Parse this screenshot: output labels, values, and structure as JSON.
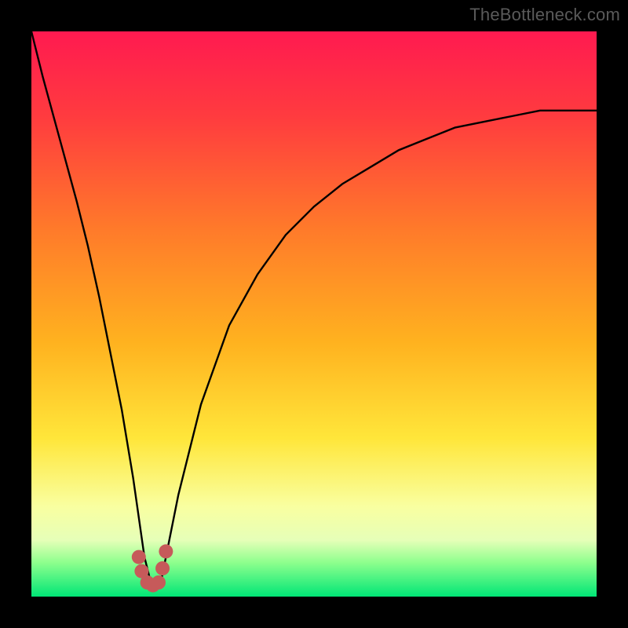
{
  "watermark": "TheBottleneck.com",
  "colors": {
    "frame": "#000000",
    "gradient_stops": [
      {
        "pct": 0,
        "color": "#ff1a50"
      },
      {
        "pct": 15,
        "color": "#ff3b3f"
      },
      {
        "pct": 35,
        "color": "#ff7a2a"
      },
      {
        "pct": 55,
        "color": "#ffb21f"
      },
      {
        "pct": 72,
        "color": "#ffe63a"
      },
      {
        "pct": 84,
        "color": "#f9ffa0"
      },
      {
        "pct": 90,
        "color": "#e6ffb8"
      },
      {
        "pct": 94,
        "color": "#8dff8d"
      },
      {
        "pct": 100,
        "color": "#00e676"
      }
    ],
    "curve_stroke": "#000000",
    "marker_fill": "#c65a5a"
  },
  "chart_data": {
    "type": "line",
    "title": "",
    "xlabel": "",
    "ylabel": "",
    "xlim": [
      0,
      100
    ],
    "ylim": [
      0,
      100
    ],
    "series": [
      {
        "name": "bottleneck-curve",
        "x": [
          0,
          2,
          5,
          8,
          10,
          12,
          14,
          16,
          18,
          19,
          20,
          21,
          22,
          23,
          24,
          26,
          30,
          35,
          40,
          45,
          50,
          55,
          60,
          65,
          70,
          75,
          80,
          85,
          90,
          95,
          100
        ],
        "y": [
          100,
          92,
          81,
          70,
          62,
          53,
          43,
          33,
          21,
          14,
          7,
          3,
          2,
          3,
          8,
          18,
          34,
          48,
          57,
          64,
          69,
          73,
          76,
          79,
          81,
          83,
          84,
          85,
          86,
          86,
          86
        ]
      }
    ],
    "markers": [
      {
        "name": "valley-left-upper",
        "x": 19.0,
        "y": 7.0
      },
      {
        "name": "valley-left-lower",
        "x": 19.5,
        "y": 4.5
      },
      {
        "name": "valley-bottom-left",
        "x": 20.5,
        "y": 2.5
      },
      {
        "name": "valley-bottom-mid",
        "x": 21.5,
        "y": 2.0
      },
      {
        "name": "valley-bottom-right",
        "x": 22.5,
        "y": 2.5
      },
      {
        "name": "valley-right-lower",
        "x": 23.2,
        "y": 5.0
      },
      {
        "name": "valley-right-upper",
        "x": 23.8,
        "y": 8.0
      }
    ],
    "marker_radius_px": 9
  }
}
